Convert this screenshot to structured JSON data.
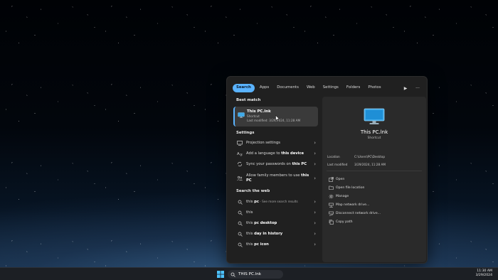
{
  "search_panel": {
    "tabs": [
      {
        "label": "Search",
        "active": true
      },
      {
        "label": "Apps"
      },
      {
        "label": "Documents"
      },
      {
        "label": "Web"
      },
      {
        "label": "Settings"
      },
      {
        "label": "Folders"
      },
      {
        "label": "Photos"
      }
    ],
    "play_icon": "▶",
    "more_icon": "···",
    "best_match": {
      "section": "Best match",
      "title": "This PC.lnk",
      "type": "Shortcut",
      "modified": "Last modified: 3/29/2024, 11:28 AM"
    },
    "settings": {
      "section": "Settings",
      "items": [
        {
          "label": "Projection settings"
        },
        {
          "pre": "Add a language to ",
          "bold": "this device"
        },
        {
          "pre": "Sync your passwords on ",
          "bold": "this PC"
        },
        {
          "pre": "Allow family members to use ",
          "bold": "this PC"
        }
      ]
    },
    "web": {
      "section": "Search the web",
      "items": [
        {
          "pre": "this ",
          "bold": "pc",
          "hint": " - See more search results"
        },
        {
          "pre": "this",
          "bold": ""
        },
        {
          "pre": "this ",
          "bold": "pc desktop"
        },
        {
          "pre": "this ",
          "bold": "day in history"
        },
        {
          "pre": "this ",
          "bold": "pc icon"
        }
      ]
    },
    "preview": {
      "title": "This PC.lnk",
      "subtitle": "Shortcut",
      "location_label": "Location",
      "location_value": "C:\\Users\\PC\\Desktop",
      "modified_label": "Last modified",
      "modified_value": "3/29/2024, 11:28 AM",
      "actions": [
        {
          "label": "Open",
          "icon": "open-icon"
        },
        {
          "label": "Open file location",
          "icon": "folder-icon"
        },
        {
          "label": "Manage",
          "icon": "gear-icon"
        },
        {
          "label": "Map network drive...",
          "icon": "network-drive-icon"
        },
        {
          "label": "Disconnect network drive...",
          "icon": "disconnect-drive-icon"
        },
        {
          "label": "Copy path",
          "icon": "copy-icon"
        }
      ]
    }
  },
  "taskbar": {
    "search_value": "THIS PC.lnk",
    "time": "11:30 AM",
    "date": "3/29/2024"
  },
  "colors": {
    "accent": "#5ab3ff",
    "panel_bg": "#202020",
    "preview_bg": "#2a2a2a",
    "taskbar_bg": "#1c1f24"
  }
}
